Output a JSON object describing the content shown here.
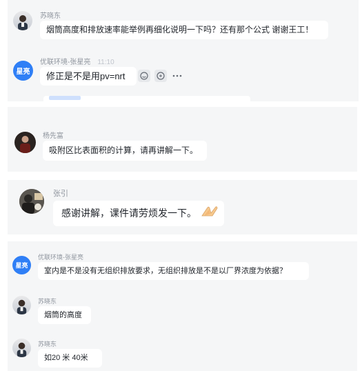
{
  "messages": [
    {
      "sender": "苏晓东",
      "text": "烟筒高度和排放速率能举例再细化说明一下吗？还有那个公式 谢谢王工！"
    },
    {
      "sender": "优联环境-张星亮",
      "time": "11:10",
      "avatar_text": "星亮",
      "text": "修正是不是用pv=nrt",
      "tools": [
        "smile-icon",
        "reply-icon",
        "more-icon"
      ]
    },
    {
      "sender": "杨先富",
      "text": "吸附区比表面积的计算，请再讲解一下。"
    },
    {
      "sender": "张引",
      "text": "感谢讲解，课件请劳烦发一下。",
      "emoji": "applause-hands-icon"
    },
    {
      "sender": "优联环境-张星亮",
      "avatar_text": "星亮",
      "text": "室内是不是没有无组织排放要求，无组织排放是不是以厂界浓度为依据？"
    },
    {
      "sender": "苏晓东",
      "text": "烟筒的高度"
    },
    {
      "sender": "苏晓东",
      "text": "如20 米 40米"
    }
  ],
  "colors": {
    "panel_bg": "#f5f6f7",
    "bubble_bg": "#ffffff",
    "accent_blue": "#2f7ff6",
    "meta_grey": "#8f959e"
  }
}
